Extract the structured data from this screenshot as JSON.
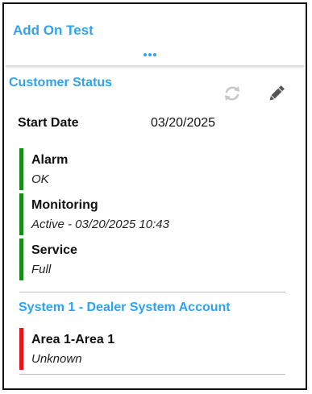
{
  "card": {
    "title": "Add On Test"
  },
  "customer_status": {
    "title": "Customer Status",
    "refresh_icon": "refresh-icon",
    "edit_icon": "pencil-icon",
    "start_date_label": "Start Date",
    "start_date_value": "03/20/2025",
    "items": [
      {
        "name": "Alarm",
        "value": "OK",
        "color": "#1a8a1a"
      },
      {
        "name": "Monitoring",
        "value": "Active - 03/20/2025 10:43",
        "color": "#1a8a1a"
      },
      {
        "name": "Service",
        "value": "Full",
        "color": "#1a8a1a"
      }
    ]
  },
  "system": {
    "title": "System 1 - Dealer System Account",
    "areas": [
      {
        "name": "Area 1-Area 1",
        "value": "Unknown",
        "color": "#e8141c"
      }
    ]
  },
  "colors": {
    "accent": "#2ea3f2",
    "ok": "#1a8a1a",
    "alert": "#e8141c"
  }
}
